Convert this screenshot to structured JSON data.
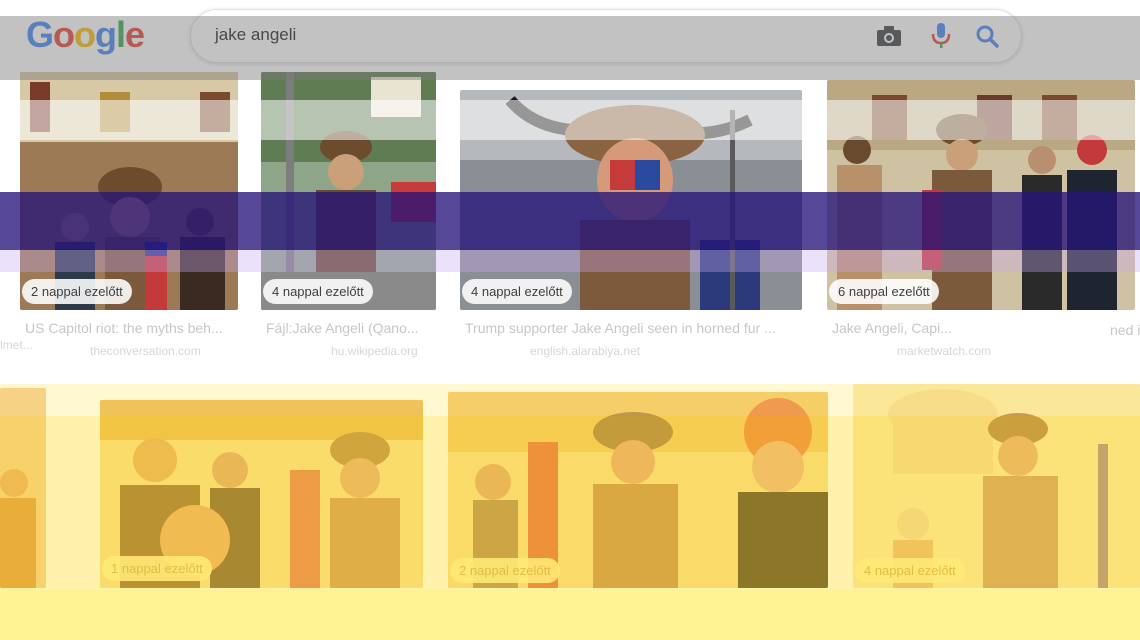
{
  "search": {
    "query": "jake angeli"
  },
  "logo": {
    "letters": [
      "G",
      "o",
      "o",
      "g",
      "l",
      "e"
    ],
    "colors": [
      "#4285F4",
      "#EA4335",
      "#FBBC05",
      "#4285F4",
      "#34A853",
      "#EA4335"
    ]
  },
  "icons": {
    "camera": "camera-icon",
    "mic": "microphone-icon",
    "search": "search-icon"
  },
  "results_row1": [
    {
      "badge": "2 nappal ezelőtt",
      "title": "US Capitol riot: the myths beh...",
      "source": "theconversation.com"
    },
    {
      "badge": "4 nappal ezelőtt",
      "title": "Fájl:Jake Angeli (Qano...",
      "source": "hu.wikipedia.org"
    },
    {
      "badge": "4 nappal ezelőtt",
      "title": "Trump supporter Jake Angeli seen in horned fur ...",
      "source": "english.alarabiya.net"
    },
    {
      "badge": "6 nappal ezelőtt",
      "title": "Jake Angeli, Capi...",
      "source": "marketwatch.com"
    }
  ],
  "results_row2": [
    {
      "badge": "1 nappal ezelőtt"
    },
    {
      "badge": "2 nappal ezelőtt"
    },
    {
      "badge": "4 nappal ezelőtt"
    }
  ],
  "fragments": {
    "left_edge_text": "lmet...",
    "right_edge_text": "ned i"
  },
  "colors": {
    "glitch_purple": "#2a1a7a",
    "glitch_yellow": "#ffee33",
    "glitch_orange": "#f39a2e"
  }
}
